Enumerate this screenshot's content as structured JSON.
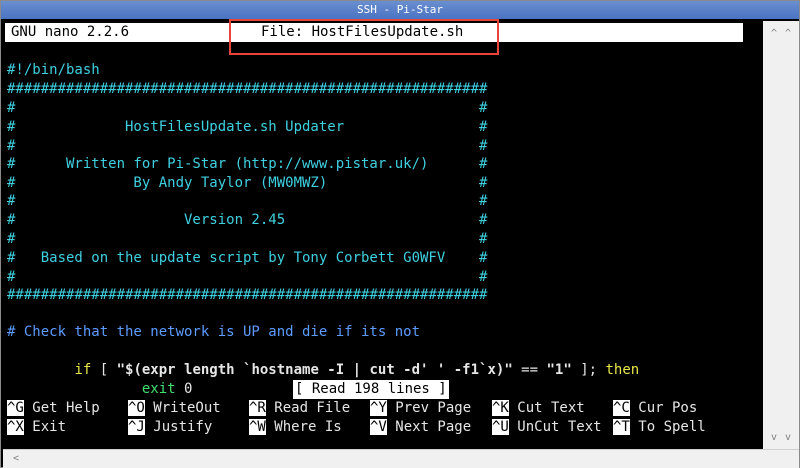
{
  "window": {
    "title": "SSH - Pi-Star"
  },
  "nano": {
    "app_version": "GNU nano 2.2.6",
    "file_label": "File: HostFilesUpdate.sh"
  },
  "file_lines": [
    "#!/bin/bash",
    "#########################################################",
    "#                                                       #",
    "#             HostFilesUpdate.sh Updater                #",
    "#                                                       #",
    "#      Written for Pi-Star (http://www.pistar.uk/)      #",
    "#              By Andy Taylor (MW0MWZ)                  #",
    "#                                                       #",
    "#                    Version 2.45                       #",
    "#                                                       #",
    "#   Based on the update script by Tony Corbett G0WFV    #",
    "#                                                       #",
    "#########################################################",
    "",
    "# Check that the network is UP and die if its not"
  ],
  "code_if": {
    "kw_if": "if",
    "bracket_open": " [ ",
    "string1": "\"$(expr length `hostname -I | cut -d' ' -f1`x)\"",
    "op": " == ",
    "string2": "\"1\"",
    "bracket_close": " ]; ",
    "kw_then": "then"
  },
  "code_exit": {
    "indent": "        ",
    "kw_exit": "exit",
    "arg": " 0"
  },
  "status_message": "[ Read 198 lines ]",
  "shortcuts": [
    {
      "key": "^G",
      "label": " Get Help"
    },
    {
      "key": "^O",
      "label": " WriteOut"
    },
    {
      "key": "^R",
      "label": " Read File"
    },
    {
      "key": "^Y",
      "label": " Prev Page"
    },
    {
      "key": "^K",
      "label": " Cut Text"
    },
    {
      "key": "^C",
      "label": " Cur Pos"
    },
    {
      "key": "^X",
      "label": " Exit"
    },
    {
      "key": "^J",
      "label": " Justify"
    },
    {
      "key": "^W",
      "label": " Where Is"
    },
    {
      "key": "^V",
      "label": " Next Page"
    },
    {
      "key": "^U",
      "label": " UnCut Text"
    },
    {
      "key": "^T",
      "label": " To Spell"
    }
  ],
  "colors": {
    "comment": "#5c9cff",
    "banner": "#3fd0e0",
    "keyword": "#e8e84a",
    "exit_keyword": "#3fe070",
    "highlight": "#e8443a"
  },
  "scroll_icons": {
    "up": "chevron-up-icon",
    "down": "chevron-down-icon",
    "left": "chevron-left-icon"
  }
}
